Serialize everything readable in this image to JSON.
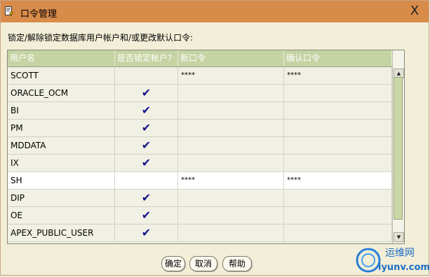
{
  "window": {
    "title": "口令管理",
    "close_label": "X"
  },
  "instruction": "锁定/解除锁定数据库用户帐户和/或更改默认口令:",
  "table": {
    "headers": [
      "用户名",
      "是否锁定帐户?",
      "新口令",
      "确认口令"
    ],
    "rows": [
      {
        "user": "SCOTT",
        "locked": false,
        "new_pw": "****",
        "confirm_pw": "****"
      },
      {
        "user": "ORACLE_OCM",
        "locked": true,
        "new_pw": "",
        "confirm_pw": ""
      },
      {
        "user": "BI",
        "locked": true,
        "new_pw": "",
        "confirm_pw": ""
      },
      {
        "user": "PM",
        "locked": true,
        "new_pw": "",
        "confirm_pw": ""
      },
      {
        "user": "MDDATA",
        "locked": true,
        "new_pw": "",
        "confirm_pw": ""
      },
      {
        "user": "IX",
        "locked": true,
        "new_pw": "",
        "confirm_pw": ""
      },
      {
        "user": "SH",
        "locked": false,
        "new_pw": "****",
        "confirm_pw": "****"
      },
      {
        "user": "DIP",
        "locked": true,
        "new_pw": "",
        "confirm_pw": ""
      },
      {
        "user": "OE",
        "locked": true,
        "new_pw": "",
        "confirm_pw": ""
      },
      {
        "user": "APEX_PUBLIC_USER",
        "locked": true,
        "new_pw": "",
        "confirm_pw": ""
      }
    ],
    "check_glyph": "✔"
  },
  "buttons": {
    "ok": "确定",
    "cancel": "取消",
    "help": "帮助"
  },
  "watermark": {
    "name": "运维网",
    "domain": "iyunv.com"
  },
  "colors": {
    "titlebar": "#d98b4a",
    "header": "#c6d3a3",
    "check": "#15158a",
    "scroll_thumb": "#c9d8a4"
  }
}
